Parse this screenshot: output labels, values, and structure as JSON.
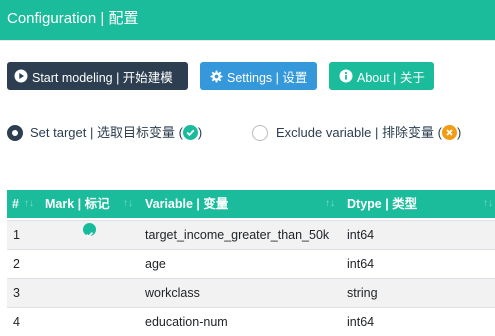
{
  "header": {
    "title": "Configuration | 配置"
  },
  "toolbar": {
    "start_label": "Start modeling | 开始建模",
    "settings_label": "Settings | 设置",
    "about_label": "About | 关于"
  },
  "options": {
    "target_label": "Set target | 选取目标变量 (",
    "target_suffix": ")",
    "exclude_label": "Exclude variable | 排除变量 (",
    "exclude_suffix": ")",
    "selected": "target"
  },
  "table": {
    "headers": [
      "#",
      "Mark | 标记",
      "Variable | 变量",
      "Dtype | 类型"
    ],
    "rows": [
      {
        "num": "1",
        "marked": true,
        "variable": "target_income_greater_than_50k",
        "dtype": "int64"
      },
      {
        "num": "2",
        "marked": false,
        "variable": "age",
        "dtype": "int64"
      },
      {
        "num": "3",
        "marked": false,
        "variable": "workclass",
        "dtype": "string"
      },
      {
        "num": "4",
        "marked": false,
        "variable": "education-num",
        "dtype": "int64"
      }
    ]
  },
  "colors": {
    "primary": "#1abc9c",
    "dark": "#2c3e50",
    "info": "#3498db",
    "warning": "#f39c12"
  },
  "icons": {
    "start": "play-circle-icon",
    "settings": "gear-icon",
    "about": "info-circle-icon",
    "target": "check-circle-icon",
    "exclude": "x-circle-icon",
    "sort": "sort-icon"
  }
}
